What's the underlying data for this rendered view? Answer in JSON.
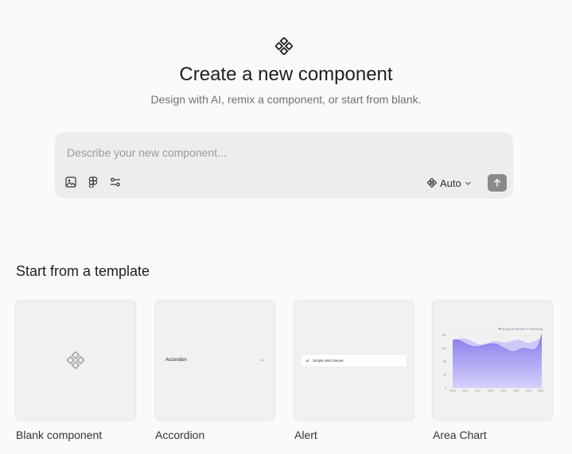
{
  "header": {
    "title": "Create a new component",
    "subtitle": "Design with AI, remix a component, or start from blank."
  },
  "composer": {
    "placeholder": "Describe your new component...",
    "model_label": "Auto"
  },
  "templates": {
    "section_title": "Start from a template",
    "items": [
      {
        "label": "Blank component"
      },
      {
        "label": "Accordion",
        "preview_text": "Accordion"
      },
      {
        "label": "Alert",
        "preview_text": "Simple alert banner"
      },
      {
        "label": "Area Chart"
      }
    ]
  },
  "area_chart_preview": {
    "legend": [
      "Biology",
      "Business",
      "Psychology"
    ],
    "y_ticks": [
      "160",
      "120",
      "80",
      "40",
      "0"
    ],
    "x_ticks": [
      "2015",
      "2016",
      "2017",
      "2018",
      "2019",
      "2020",
      "2021",
      "2022"
    ]
  },
  "colors": {
    "background": "#fafafa",
    "composer_bg": "#ededed",
    "send_button": "#8a8a8a",
    "chart_fill": "#8f85f0"
  }
}
